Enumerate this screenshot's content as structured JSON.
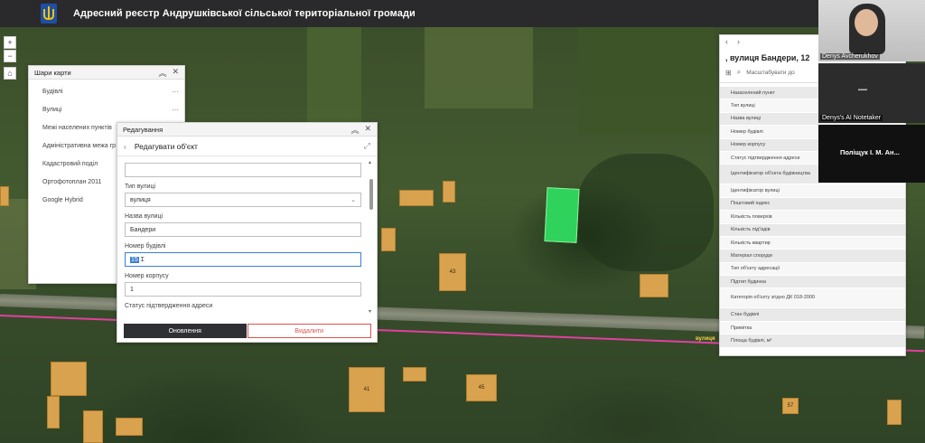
{
  "header": {
    "title": "Адресний реєстр Андрушківської сільської територіальної громади"
  },
  "map": {
    "street_label": "вулиця",
    "house_numbers": [
      "43",
      "41",
      "45",
      "43",
      "57"
    ]
  },
  "layers_panel": {
    "title": "Шари карти",
    "items": [
      {
        "label": "Будівлі"
      },
      {
        "label": "Вулиці"
      },
      {
        "label": "Межі населених пунктів"
      },
      {
        "label": "Адміністративна межа гр"
      },
      {
        "label": "Кадастровий поділ"
      },
      {
        "label": "Ортофотоплан 2011"
      },
      {
        "label": "Google Hybrid"
      }
    ]
  },
  "edit_panel": {
    "title": "Редагування",
    "subtitle": "Редагувати об'єкт",
    "fields": {
      "street_type_label": "Тип вулиці",
      "street_type_value": "вулиця",
      "street_name_label": "Назва вулиці",
      "street_name_value": "Бандери",
      "building_number_label": "Номер будівлі",
      "building_number_value": "15",
      "housing_number_label": "Номер корпусу",
      "housing_number_value": "1",
      "next_label": "Статус підтвердження адреси"
    },
    "update_button": "Оновлення",
    "delete_button": "Видалити"
  },
  "attributes_panel": {
    "title": ", вулиця Бандери, 12",
    "zoom_label": "Масштабувати до",
    "rows": [
      "Назаселений пункт",
      "Тип вулиці",
      "Назва вулиці",
      "Номер будівлі",
      "Номер корпусу",
      "Статус підтвердження адреси",
      "Ідентифікатор об'єкта будівництва",
      "Ідентифікатор вулиці",
      "Поштовий індекс",
      "Кількість поверхів",
      "Кількість під'їздів",
      "Кількість квартир",
      "Матеріал споруди",
      "Тип об'єкту адресації",
      "Підтип будинка",
      "Категорія об'єкту згідно ДК 018-2000",
      "Стан будівлі",
      "Примітка",
      "Площа будівлі, м²"
    ]
  },
  "video_tiles": [
    {
      "name": "Denys Avcherukhov"
    },
    {
      "name": "Denys's AI Notetaker"
    },
    {
      "name": "Поліщук І. М. Ан..."
    }
  ],
  "colors": {
    "header_bg": "#2a2a2c",
    "selected_plot": "#2fd25a",
    "accent_blue": "#3a7fd5",
    "delete_red": "#d9534f"
  }
}
